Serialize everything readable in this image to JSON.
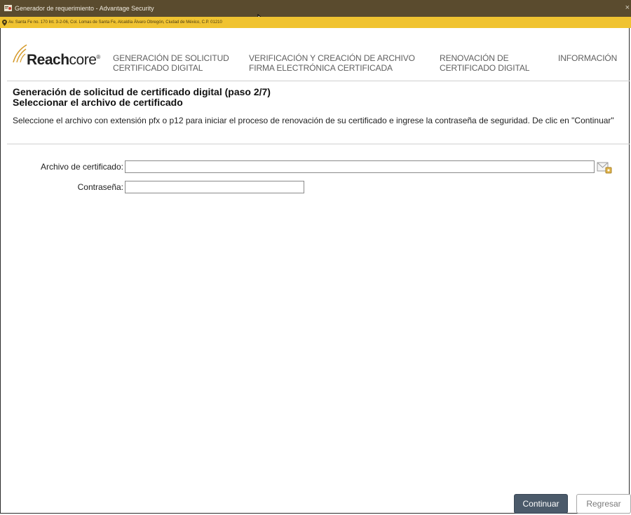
{
  "window": {
    "title": "Generador de requerimiento - Advantage Security",
    "close_glyph": "×",
    "app_icon": "certificate-app-icon"
  },
  "address_bar": {
    "text": "Av. Santa Fe no. 170 Int. 3-2-06, Col. Lomas de Santa Fe, Alcaldía Álvaro Obregón, Ciudad de México, C.P. 01210",
    "icon": "location-pin-icon",
    "color": "#f0c331"
  },
  "brand": {
    "name_bold": "Reach",
    "name_rest": "core",
    "mark": "®"
  },
  "nav": [
    {
      "line1": "GENERACIÓN DE SOLICITUD",
      "line2": "CERTIFICADO DIGITAL"
    },
    {
      "line1": "VERIFICACIÓN Y CREACIÓN DE ARCHIVO",
      "line2": "FIRMA ELECTRÓNICA CERTIFICADA"
    },
    {
      "line1": "RENOVACIÓN DE",
      "line2": "CERTIFICADO DIGITAL"
    },
    {
      "line1": "INFORMACIÓN",
      "line2": ""
    }
  ],
  "page": {
    "title_line1": "Generación de solicitud de certificado digital (paso 2/7)",
    "title_line2": "Seleccionar el archivo de certificado",
    "instructions": "Seleccione el archivo con extensión pfx o p12 para iniciar el proceso de renovación de su certificado e ingrese la contraseña de seguridad.  De clic en \"Continuar\""
  },
  "form": {
    "certificate_label": "Archivo de certificado:",
    "certificate_value": "",
    "password_label": "Contraseña:",
    "password_value": "",
    "browse_icon": "browse-file-icon"
  },
  "buttons": {
    "continue": "Continuar",
    "back": "Regresar"
  },
  "colors": {
    "titlebar": "#5a4b2e",
    "primary_button": "#4b5a6a"
  }
}
